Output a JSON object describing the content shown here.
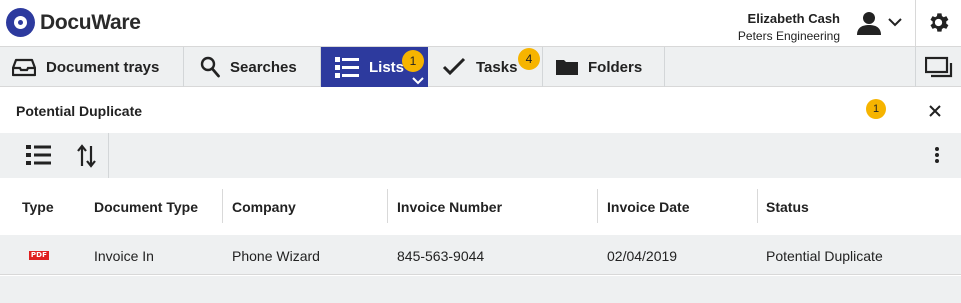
{
  "header": {
    "logo_text": "DocuWare",
    "user_name": "Elizabeth Cash",
    "user_company": "Peters Engineering"
  },
  "tabs": [
    {
      "label": "Document trays",
      "icon": "tray-icon",
      "active": false
    },
    {
      "label": "Searches",
      "icon": "search-icon",
      "active": false
    },
    {
      "label": "Lists",
      "icon": "list-icon",
      "active": true,
      "badge": "1"
    },
    {
      "label": "Tasks",
      "icon": "checkmark-icon",
      "active": false,
      "badge": "4"
    },
    {
      "label": "Folders",
      "icon": "folder-icon",
      "active": false
    }
  ],
  "panel": {
    "title": "Potential Duplicate",
    "count_badge": "1"
  },
  "table": {
    "columns": [
      "Type",
      "Document Type",
      "Company",
      "Invoice Number",
      "Invoice Date",
      "Status"
    ],
    "rows": [
      {
        "type_icon": "PDF",
        "document_type": "Invoice In",
        "company": "Phone Wizard",
        "invoice_number": "845-563-9044",
        "invoice_date": "02/04/2019",
        "status": "Potential Duplicate"
      }
    ]
  },
  "colors": {
    "brand": "#2d3a9e",
    "badge": "#f6b400",
    "toolbar_bg": "#eef0f1",
    "pdf_red": "#e02020"
  }
}
